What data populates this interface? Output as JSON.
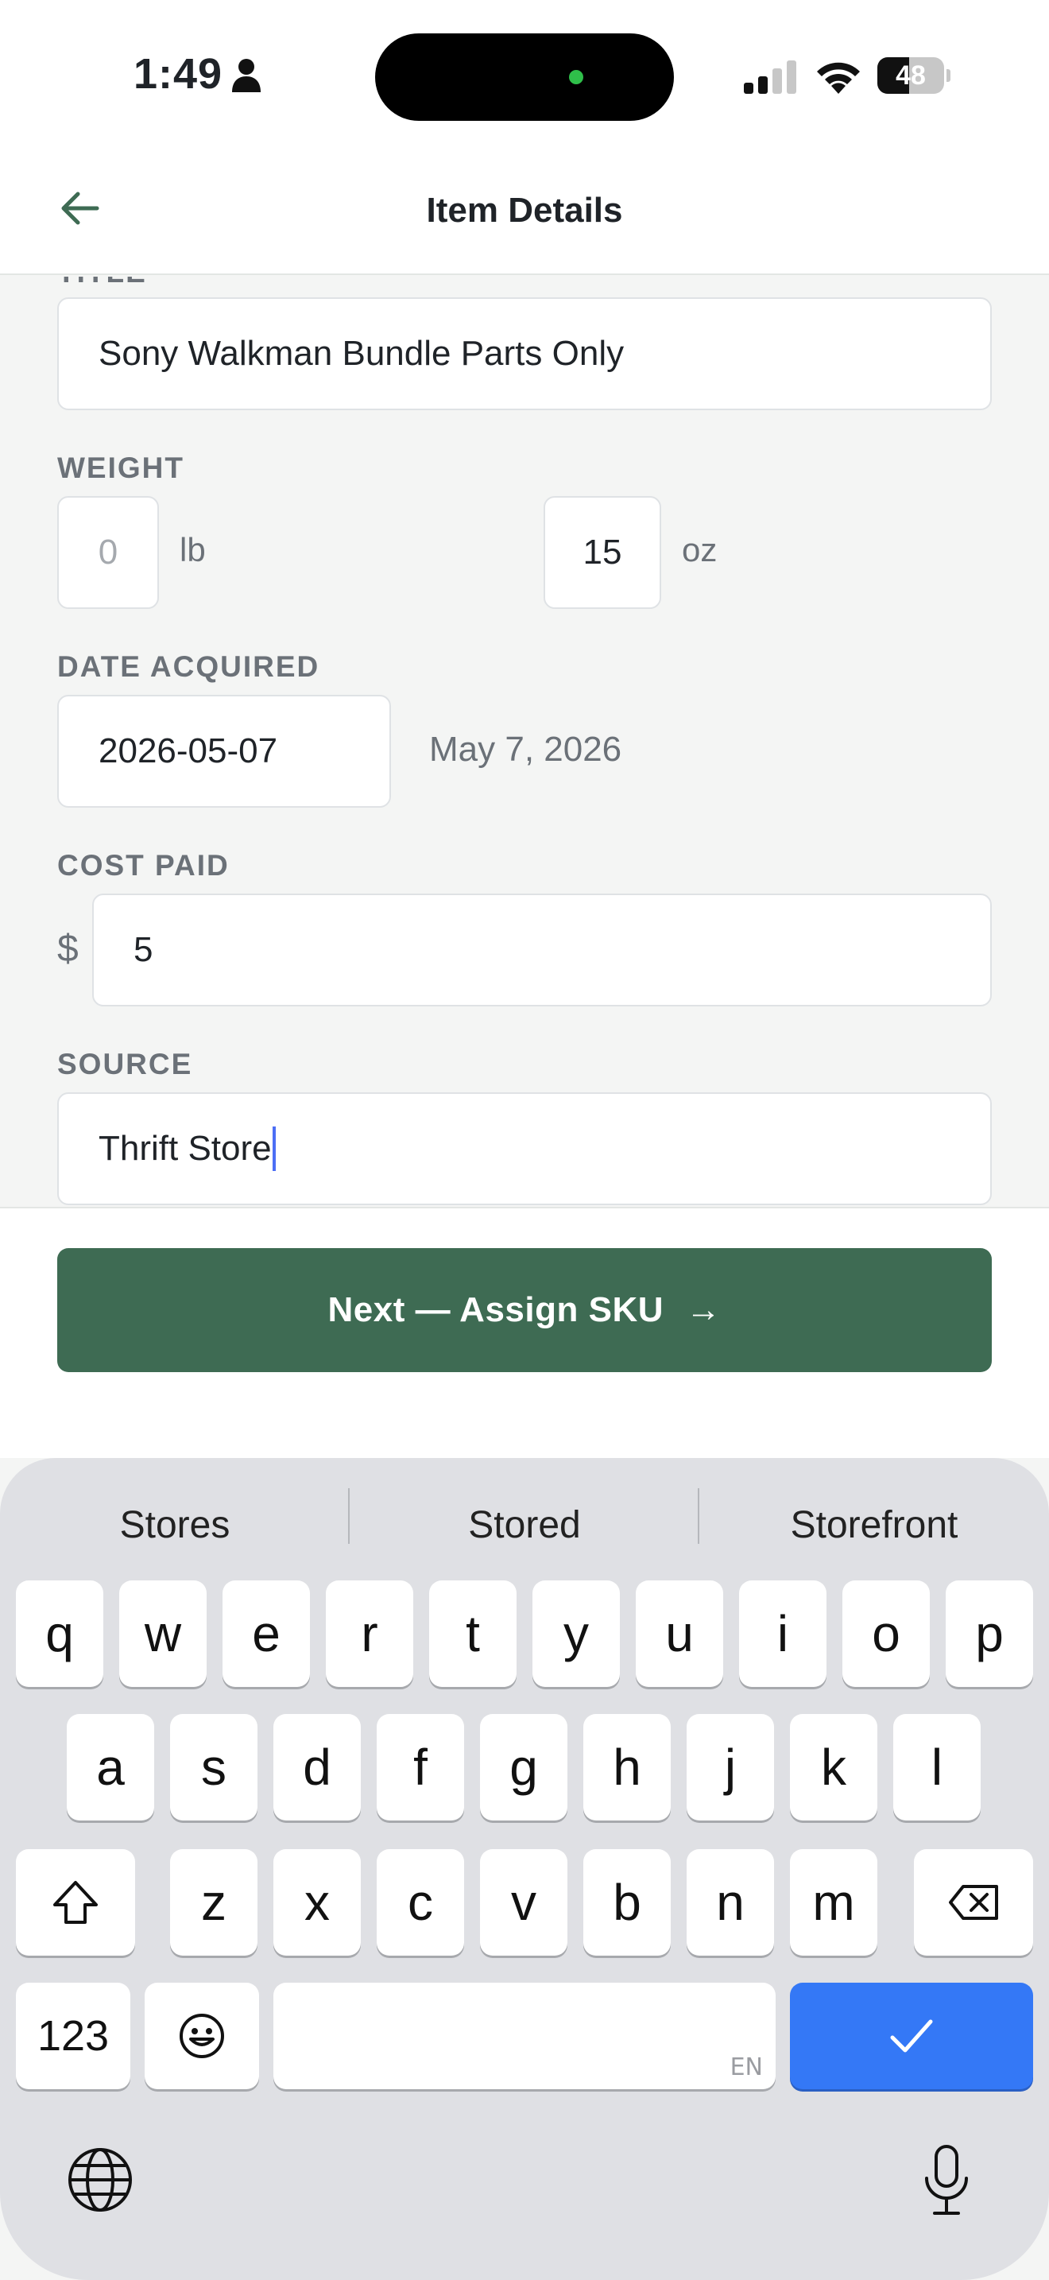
{
  "status_bar": {
    "time": "1:49",
    "battery": "48",
    "battery_level": 0.48
  },
  "header": {
    "title": "Item Details"
  },
  "form": {
    "title_label": "TITLE",
    "title_value": "Sony Walkman Bundle Parts Only",
    "weight_label": "WEIGHT",
    "weight_lb_placeholder": "0",
    "weight_lb_unit": "lb",
    "weight_oz_value": "15",
    "weight_oz_unit": "oz",
    "date_label": "DATE ACQUIRED",
    "date_value": "2026-05-07",
    "date_display": "May 7, 2026",
    "cost_label": "COST PAID",
    "currency_symbol": "$",
    "cost_value": "5",
    "source_label": "SOURCE",
    "source_value": "Thrift Store"
  },
  "actions": {
    "next_label": "Next — Assign SKU",
    "next_arrow": "→"
  },
  "keyboard": {
    "suggestions": [
      "Stores",
      "Stored",
      "Storefront"
    ],
    "row1": [
      "q",
      "w",
      "e",
      "r",
      "t",
      "y",
      "u",
      "i",
      "o",
      "p"
    ],
    "row2": [
      "a",
      "s",
      "d",
      "f",
      "g",
      "h",
      "j",
      "k",
      "l"
    ],
    "row3": [
      "z",
      "x",
      "c",
      "v",
      "b",
      "n",
      "m"
    ],
    "numbers_key": "123",
    "space_lang": "EN",
    "return_color": "#3478f6"
  },
  "colors": {
    "primary": "#3e6b53",
    "background": "#f4f5f4",
    "label": "#6b7178",
    "caret": "#4c6ef5"
  }
}
